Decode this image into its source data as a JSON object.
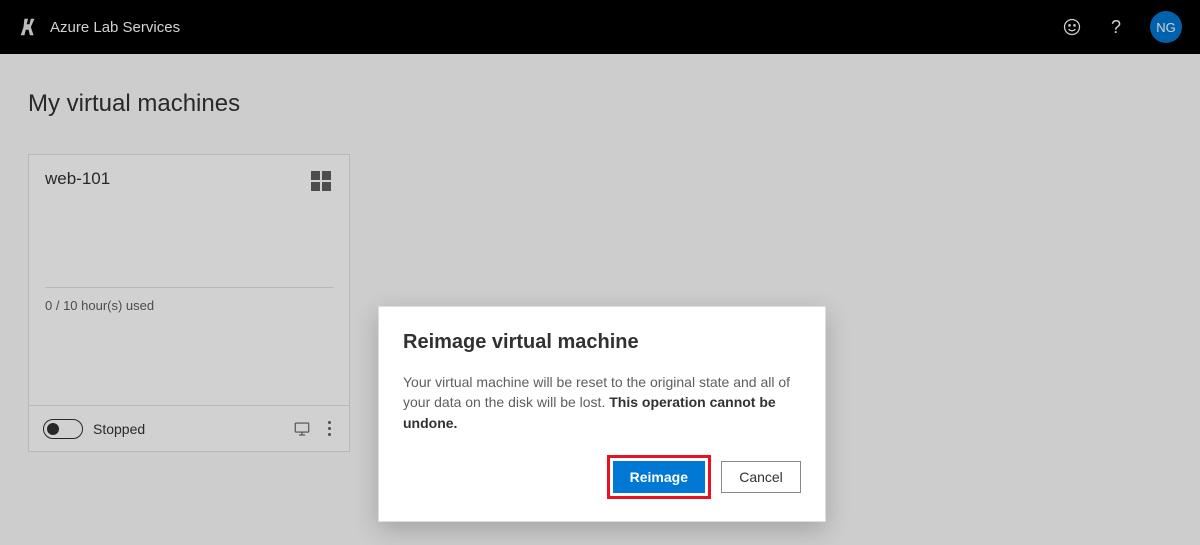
{
  "header": {
    "app_title": "Azure Lab Services",
    "user_initials": "NG"
  },
  "page": {
    "title": "My virtual machines"
  },
  "vm": {
    "name": "web-101",
    "os": "windows",
    "usage_text": "0 / 10 hour(s) used",
    "status": "Stopped"
  },
  "dialog": {
    "title": "Reimage virtual machine",
    "body_pre": "Your virtual machine will be reset to the original state and all of your data on the disk will be lost. ",
    "body_strong": "This operation cannot be undone.",
    "primary": "Reimage",
    "secondary": "Cancel"
  }
}
